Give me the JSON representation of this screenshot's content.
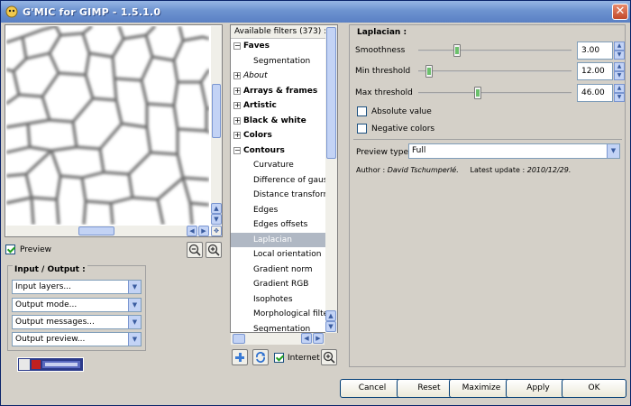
{
  "window": {
    "title": "G'MIC for GIMP - 1.5.1.0"
  },
  "preview": {
    "checkbox_label": "Preview",
    "checked": true
  },
  "io": {
    "title": "Input / Output :",
    "dropdowns": [
      "Input layers...",
      "Output mode...",
      "Output messages...",
      "Output preview..."
    ]
  },
  "filters": {
    "header": "Available filters (373) :",
    "items": [
      {
        "label": "Faves",
        "kind": "cat",
        "expander": "−"
      },
      {
        "label": "Segmentation",
        "kind": "sub"
      },
      {
        "label": "About",
        "kind": "cat-italic",
        "expander": "+"
      },
      {
        "label": "Arrays & frames",
        "kind": "cat",
        "expander": "+"
      },
      {
        "label": "Artistic",
        "kind": "cat",
        "expander": "+"
      },
      {
        "label": "Black & white",
        "kind": "cat",
        "expander": "+"
      },
      {
        "label": "Colors",
        "kind": "cat",
        "expander": "+"
      },
      {
        "label": "Contours",
        "kind": "cat",
        "expander": "−"
      },
      {
        "label": "Curvature",
        "kind": "sub"
      },
      {
        "label": "Difference of gaussi",
        "kind": "sub"
      },
      {
        "label": "Distance transform",
        "kind": "sub"
      },
      {
        "label": "Edges",
        "kind": "sub"
      },
      {
        "label": "Edges offsets",
        "kind": "sub"
      },
      {
        "label": "Laplacian",
        "kind": "sub",
        "selected": true
      },
      {
        "label": "Local orientation",
        "kind": "sub"
      },
      {
        "label": "Gradient norm",
        "kind": "sub"
      },
      {
        "label": "Gradient RGB",
        "kind": "sub"
      },
      {
        "label": "Isophotes",
        "kind": "sub"
      },
      {
        "label": "Morphological filter",
        "kind": "sub"
      },
      {
        "label": "Segmentation",
        "kind": "sub"
      }
    ],
    "internet_label": "Internet",
    "internet_checked": true
  },
  "params": {
    "title": "Laplacian :",
    "sliders": [
      {
        "label": "Smoothness",
        "value": "3.00",
        "fraction": 0.24
      },
      {
        "label": "Min threshold",
        "value": "12.00",
        "fraction": 0.05
      },
      {
        "label": "Max threshold",
        "value": "46.00",
        "fraction": 0.38
      }
    ],
    "checkboxes": [
      {
        "label": "Absolute value",
        "checked": false
      },
      {
        "label": "Negative colors",
        "checked": false
      }
    ],
    "preview_type_label": "Preview type",
    "preview_type_value": "Full",
    "author_prefix": "Author :",
    "author_name": "David Tschumperlé.",
    "update_prefix": "Latest update :",
    "update_date": "2010/12/29."
  },
  "buttons": {
    "cancel": "Cancel",
    "reset": "Reset",
    "maximize": "Maximize",
    "apply": "Apply",
    "ok": "OK"
  },
  "colors": {
    "title_bar": "#6d93d0",
    "close_button": "#c24a2c",
    "selection": "#b0b8c4",
    "slider_handle": "#6cc06c"
  }
}
